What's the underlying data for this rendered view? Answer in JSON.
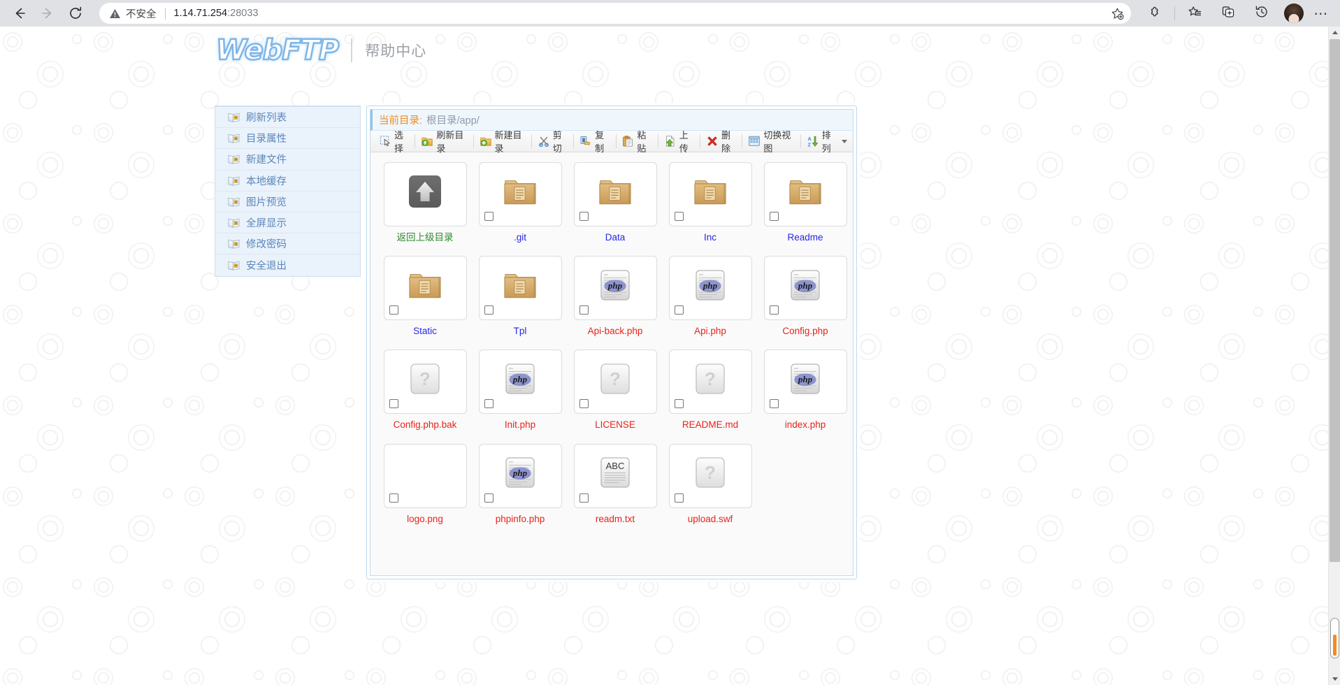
{
  "browser": {
    "back_icon": "back-arrow-icon",
    "forward_icon": "forward-arrow-icon",
    "reload_icon": "reload-icon",
    "security_label": "不安全",
    "url": "1.14.71.254",
    "url_port": ":28033",
    "star_icon": "add-favorite-icon",
    "extensions_icon": "extensions-icon",
    "favorites_icon": "favorites-list-icon",
    "collections_icon": "collections-icon",
    "history_icon": "history-icon",
    "avatar_icon": "profile-avatar",
    "more_icon": "more-options-icon"
  },
  "header": {
    "logo_text": "WebFTP",
    "help_center": "帮助中心"
  },
  "sidebar": {
    "items": [
      {
        "label": "刷新列表",
        "icon": "book-icon"
      },
      {
        "label": "目录属性",
        "icon": "book-icon"
      },
      {
        "label": "新建文件",
        "icon": "book-icon"
      },
      {
        "label": "本地缓存",
        "icon": "book-icon"
      },
      {
        "label": "图片预览",
        "icon": "book-icon"
      },
      {
        "label": "全屏显示",
        "icon": "book-icon"
      },
      {
        "label": "修改密码",
        "icon": "book-icon"
      },
      {
        "label": "安全退出",
        "icon": "book-icon"
      }
    ]
  },
  "panel": {
    "current_dir_label": "当前目录:",
    "current_dir_path": "根目录/app/",
    "toolbar": [
      {
        "label": "选择",
        "icon": "select-icon"
      },
      {
        "label": "刷新目录",
        "icon": "refresh-folder-icon"
      },
      {
        "label": "新建目录",
        "icon": "new-folder-icon"
      },
      {
        "label": "剪切",
        "icon": "scissors-icon"
      },
      {
        "label": "复制",
        "icon": "copy-icon"
      },
      {
        "label": "粘贴",
        "icon": "paste-icon"
      },
      {
        "label": "上传",
        "icon": "upload-icon"
      },
      {
        "label": "删除",
        "icon": "delete-icon"
      },
      {
        "label": "切换视图",
        "icon": "grid-view-icon"
      },
      {
        "label": "排列",
        "icon": "sort-az-icon",
        "has_caret": true
      }
    ],
    "files": [
      {
        "name": "返回上级目录",
        "type": "up",
        "icon": "up-arrow-icon",
        "checkbox": false,
        "name_class": "name-up"
      },
      {
        "name": ".git",
        "type": "folder",
        "icon": "folder-icon",
        "checkbox": true,
        "name_class": "name-dir"
      },
      {
        "name": "Data",
        "type": "folder",
        "icon": "folder-icon",
        "checkbox": true,
        "name_class": "name-dir"
      },
      {
        "name": "Inc",
        "type": "folder",
        "icon": "folder-icon",
        "checkbox": true,
        "name_class": "name-dir"
      },
      {
        "name": "Readme",
        "type": "folder",
        "icon": "folder-icon",
        "checkbox": true,
        "name_class": "name-dir"
      },
      {
        "name": "Static",
        "type": "folder",
        "icon": "folder-icon",
        "checkbox": true,
        "name_class": "name-dir"
      },
      {
        "name": "Tpl",
        "type": "folder",
        "icon": "folder-icon",
        "checkbox": true,
        "name_class": "name-dir"
      },
      {
        "name": "Api-back.php",
        "type": "php",
        "icon": "php-file-icon",
        "checkbox": true,
        "name_class": "name-file"
      },
      {
        "name": "Api.php",
        "type": "php",
        "icon": "php-file-icon",
        "checkbox": true,
        "name_class": "name-file"
      },
      {
        "name": "Config.php",
        "type": "php",
        "icon": "php-file-icon",
        "checkbox": true,
        "name_class": "name-file"
      },
      {
        "name": "Config.php.bak",
        "type": "unknown",
        "icon": "unknown-file-icon",
        "checkbox": true,
        "name_class": "name-file"
      },
      {
        "name": "Init.php",
        "type": "php",
        "icon": "php-file-icon",
        "checkbox": true,
        "name_class": "name-file"
      },
      {
        "name": "LICENSE",
        "type": "unknown",
        "icon": "unknown-file-icon",
        "checkbox": true,
        "name_class": "name-file"
      },
      {
        "name": "README.md",
        "type": "unknown",
        "icon": "unknown-file-icon",
        "checkbox": true,
        "name_class": "name-file"
      },
      {
        "name": "index.php",
        "type": "php",
        "icon": "php-file-icon",
        "checkbox": true,
        "name_class": "name-file"
      },
      {
        "name": "logo.png",
        "type": "image",
        "icon": "broken-image-icon",
        "checkbox": true,
        "name_class": "name-file"
      },
      {
        "name": "phpinfo.php",
        "type": "php",
        "icon": "php-file-icon",
        "checkbox": true,
        "name_class": "name-file"
      },
      {
        "name": "readm.txt",
        "type": "text",
        "icon": "text-file-icon",
        "checkbox": true,
        "name_class": "name-file"
      },
      {
        "name": "upload.swf",
        "type": "unknown",
        "icon": "unknown-file-icon",
        "checkbox": true,
        "name_class": "name-file"
      }
    ]
  },
  "colors": {
    "accent_orange": "#f08a1e",
    "link_dir": "#2727e8",
    "link_file": "#e8231a",
    "link_up": "#2e8b2e",
    "sidebar_bg": "#eaf2fb",
    "sidebar_text": "#5b87ba"
  }
}
